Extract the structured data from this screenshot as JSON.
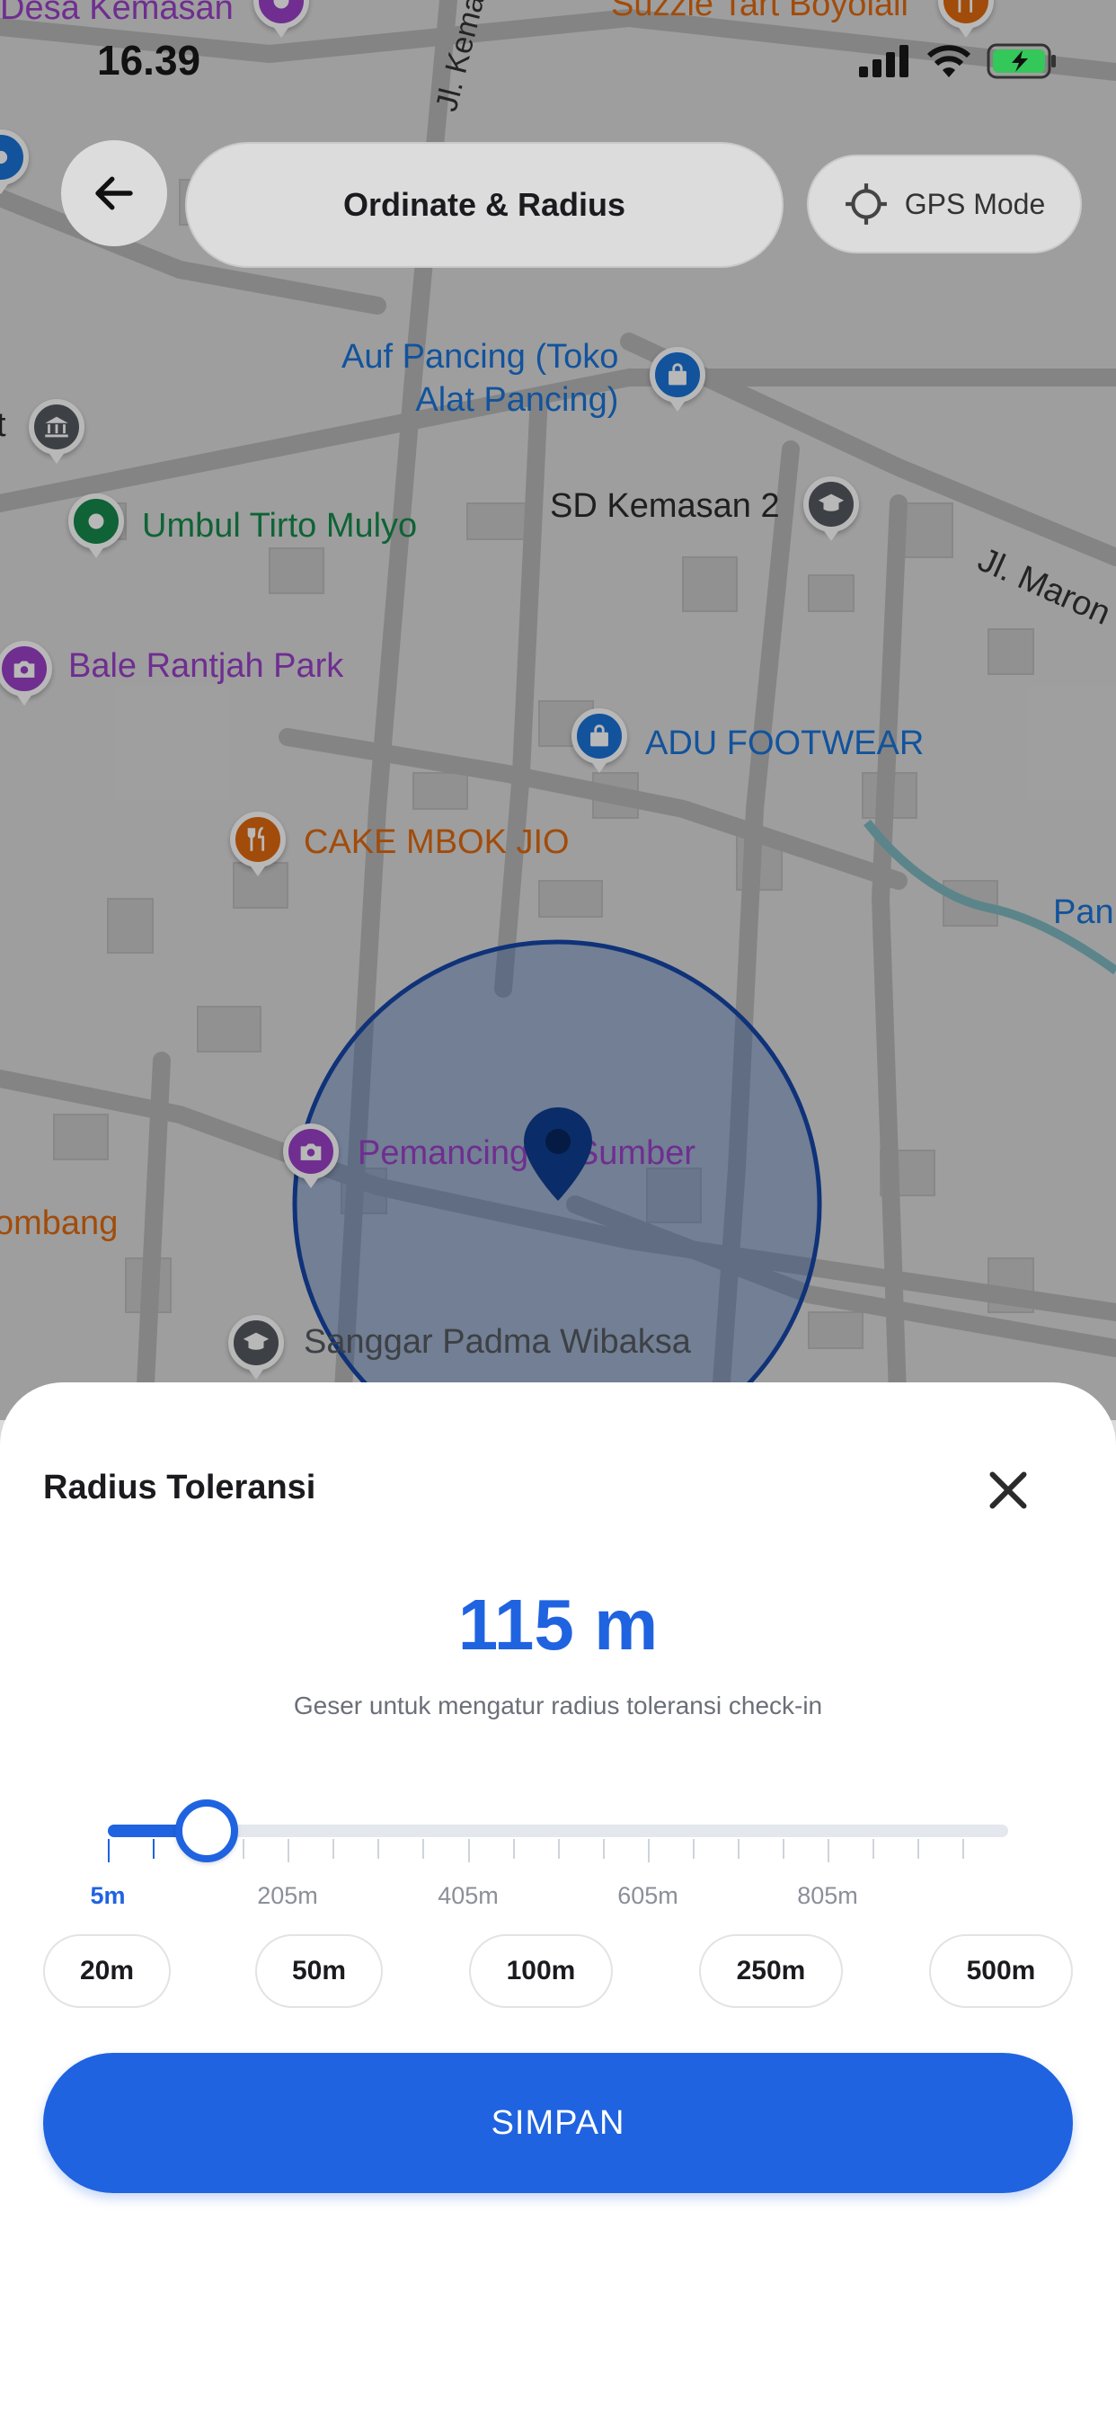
{
  "status_bar": {
    "time": "16.39"
  },
  "header": {
    "title": "Ordinate & Radius",
    "gps_label": "GPS Mode"
  },
  "map": {
    "streets": [
      "Jl. Kemasan",
      "Jl. Maron"
    ],
    "pois": [
      {
        "name": "Desa Kemasan",
        "category": "place",
        "color": "#9a40c8"
      },
      {
        "name": "Suzzie Tart Boyolali",
        "category": "food",
        "color": "#e06a10"
      },
      {
        "name": "Auf Pancing (Toko\nAlat Pancing)",
        "category": "shopping-bag",
        "color": "#1a73d9"
      },
      {
        "name": "Umbul Tirto Mulyo",
        "category": "park",
        "color": "#168a4c"
      },
      {
        "name": "SD Kemasan 2",
        "category": "school",
        "color": "#555a60"
      },
      {
        "name": "Bale Rantjah Park",
        "category": "camera",
        "color": "#9a40c8"
      },
      {
        "name": "ADU FOOTWEAR",
        "category": "shopping-bag",
        "color": "#1a73d9"
      },
      {
        "name": "CAKE MBOK JIO",
        "category": "food",
        "color": "#e06a10"
      },
      {
        "name": "Pemancingan Sumber",
        "category": "camera",
        "color": "#9a40c8"
      },
      {
        "name": "Sanggar Padma Wibaksa",
        "category": "school",
        "color": "#555a60"
      },
      {
        "name": "ombang",
        "category": "food",
        "color": "#e06a10"
      },
      {
        "name": "Pan",
        "category": "place",
        "color": "#1a73d9"
      }
    ]
  },
  "sheet": {
    "title": "Radius Toleransi",
    "value_label": "115 m",
    "hint": "Geser untuk mengatur radius toleransi check-in",
    "slider": {
      "min": 5,
      "max": 1005,
      "value": 115
    },
    "tick_labels": [
      "5m",
      "205m",
      "405m",
      "605m",
      "805m"
    ],
    "presets": [
      "20m",
      "50m",
      "100m",
      "250m",
      "500m"
    ],
    "save_label": "SIMPAN"
  },
  "colors": {
    "accent": "#1f63e0",
    "circle_fill": "#2d5fb5",
    "dark_text": "#1b1b1f"
  }
}
